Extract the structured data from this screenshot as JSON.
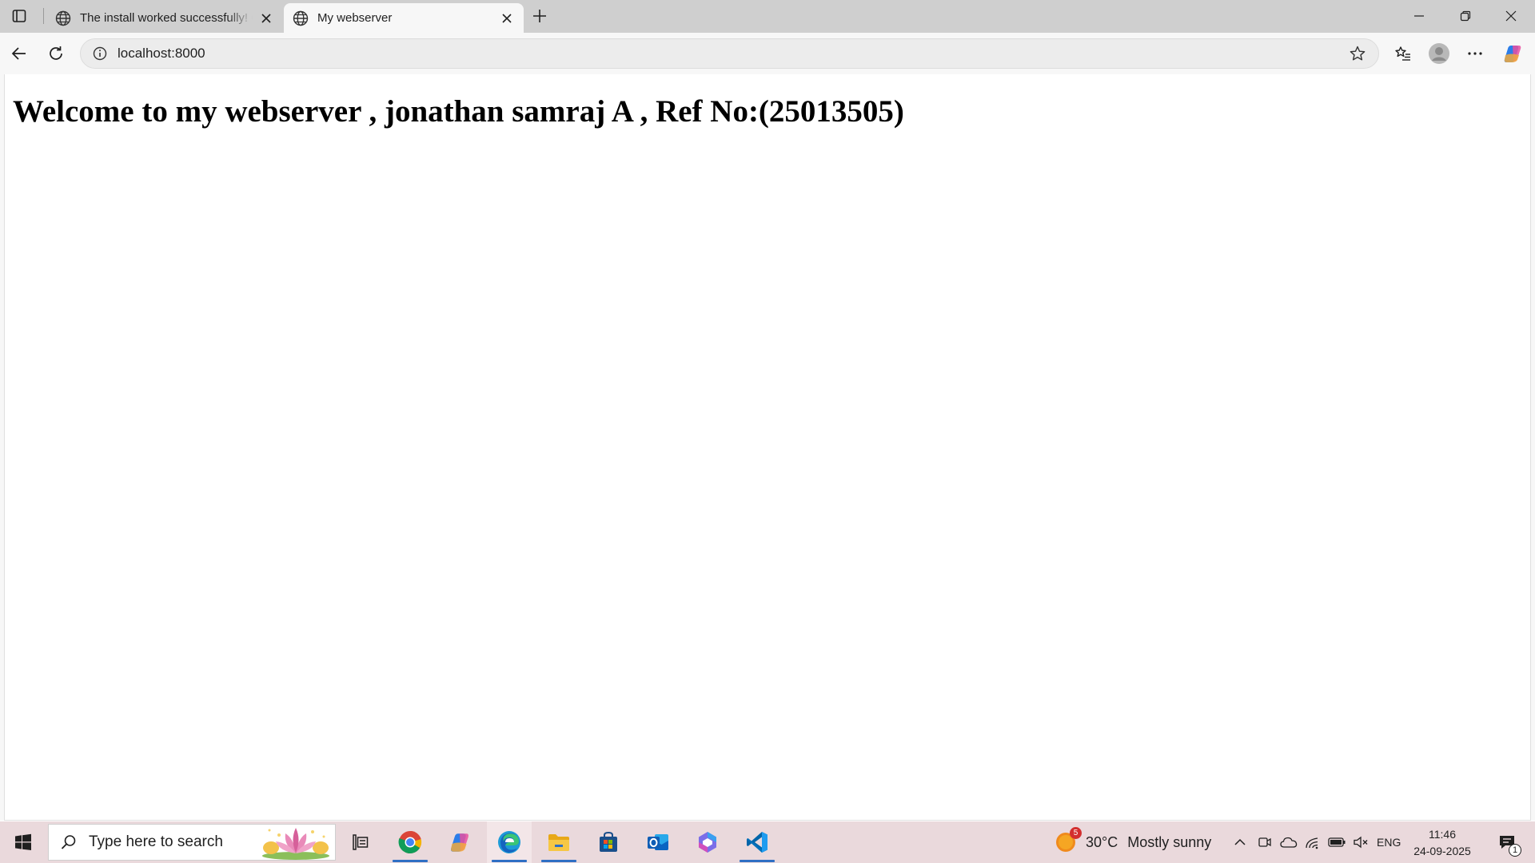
{
  "browser": {
    "tabs": [
      {
        "title": "The install worked successfully! Congratulations!",
        "active": false
      },
      {
        "title": "My webserver",
        "active": true
      }
    ],
    "address": {
      "url": "localhost:8000"
    }
  },
  "page": {
    "heading": "Welcome to my webserver , jonathan samraj A , Ref No:(25013505)"
  },
  "taskbar": {
    "search_placeholder": "Type here to search",
    "pinned_apps": [
      "chrome-icon",
      "copilot-icon",
      "edge-icon",
      "file-explorer-icon",
      "microsoft-store-icon",
      "outlook-icon",
      "m365-copilot-icon",
      "vscode-icon"
    ],
    "weather": {
      "badge": "5",
      "temperature": "30°C",
      "condition": "Mostly sunny"
    },
    "language": "ENG",
    "time": "11:46",
    "date": "24-09-2025",
    "notifications": "1"
  },
  "colors": {
    "taskbar_bg": "#ead9dc",
    "tabstrip_bg": "#cfcfcf",
    "running_indicator": "#2f6fc4"
  }
}
